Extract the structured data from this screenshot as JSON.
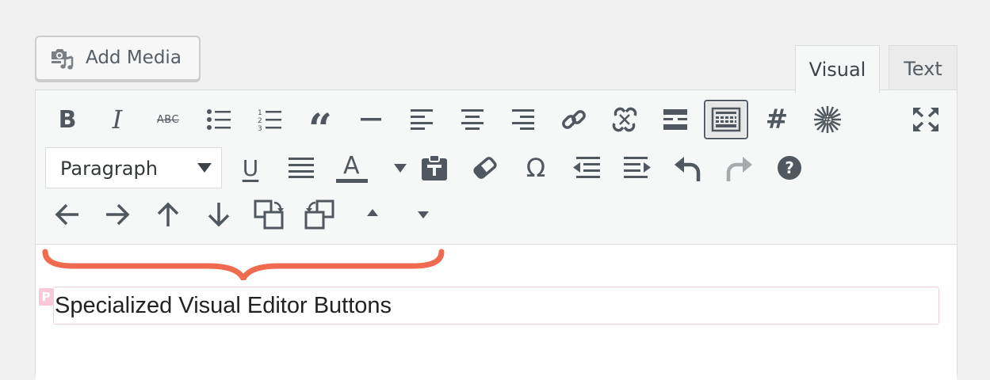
{
  "add_media": {
    "label": "Add Media",
    "icon": "camera-music-icon"
  },
  "tabs": [
    {
      "label": "Visual",
      "active": true
    },
    {
      "label": "Text",
      "active": false
    }
  ],
  "toolbar": {
    "row1": [
      {
        "name": "bold-button",
        "icon": "bold-icon",
        "glyph": "B"
      },
      {
        "name": "italic-button",
        "icon": "italic-icon",
        "glyph": "I"
      },
      {
        "name": "strikethrough-button",
        "icon": "strikethrough-icon",
        "glyph": "ABC"
      },
      {
        "name": "bulleted-list-button",
        "icon": "bulleted-list-icon"
      },
      {
        "name": "numbered-list-button",
        "icon": "numbered-list-icon"
      },
      {
        "name": "blockquote-button",
        "icon": "blockquote-icon",
        "glyph": "“"
      },
      {
        "name": "horizontal-line-button",
        "icon": "horizontal-line-icon"
      },
      {
        "name": "align-left-button",
        "icon": "align-left-icon"
      },
      {
        "name": "align-center-button",
        "icon": "align-center-icon"
      },
      {
        "name": "align-right-button",
        "icon": "align-right-icon"
      },
      {
        "name": "insert-link-button",
        "icon": "link-icon"
      },
      {
        "name": "remove-link-button",
        "icon": "unlink-icon"
      },
      {
        "name": "read-more-button",
        "icon": "read-more-icon"
      },
      {
        "name": "toolbar-toggle-button",
        "icon": "toolbar-toggle-icon",
        "active": true
      },
      {
        "name": "hashtag-button",
        "icon": "hashtag-icon",
        "glyph": "#"
      },
      {
        "name": "special-hashtag-button",
        "icon": "hashtag-burst-icon",
        "glyph": "#"
      },
      {
        "name": "fullscreen-button",
        "icon": "fullscreen-icon"
      }
    ],
    "format_select": {
      "value": "Paragraph",
      "icon": "chevron-down-icon"
    },
    "row2": [
      {
        "name": "underline-button",
        "icon": "underline-icon",
        "glyph": "U"
      },
      {
        "name": "justify-button",
        "icon": "justify-icon"
      },
      {
        "name": "text-color-button",
        "icon": "text-color-icon",
        "glyph": "A"
      },
      {
        "name": "text-color-dropdown-button",
        "icon": "caret-down-icon"
      },
      {
        "name": "paste-as-text-button",
        "icon": "clipboard-icon"
      },
      {
        "name": "clear-formatting-button",
        "icon": "eraser-icon"
      },
      {
        "name": "special-character-button",
        "icon": "omega-icon",
        "glyph": "Ω"
      },
      {
        "name": "outdent-button",
        "icon": "outdent-icon"
      },
      {
        "name": "indent-button",
        "icon": "indent-icon"
      },
      {
        "name": "undo-button",
        "icon": "undo-icon"
      },
      {
        "name": "redo-button",
        "icon": "redo-icon",
        "disabled": true
      },
      {
        "name": "help-button",
        "icon": "help-icon",
        "glyph": "?"
      }
    ],
    "row3": [
      {
        "name": "move-left-button",
        "icon": "arrow-left-icon"
      },
      {
        "name": "move-right-button",
        "icon": "arrow-right-icon"
      },
      {
        "name": "move-up-button",
        "icon": "arrow-up-icon"
      },
      {
        "name": "move-down-button",
        "icon": "arrow-down-icon"
      },
      {
        "name": "swap-forward-button",
        "icon": "swap-forward-icon"
      },
      {
        "name": "swap-back-button",
        "icon": "swap-back-icon"
      },
      {
        "name": "triangle-up-button",
        "icon": "triangle-up-icon"
      },
      {
        "name": "triangle-down-button",
        "icon": "triangle-down-icon"
      }
    ]
  },
  "content": {
    "paragraph_marker": "P",
    "paragraph_text": "Specialized Visual Editor Buttons"
  },
  "colors": {
    "icon": "#50575e",
    "disabled_icon": "#a7aaad",
    "brace_annotation": "#ef6a4f",
    "paragraph_outline": "#f5cdd9"
  }
}
